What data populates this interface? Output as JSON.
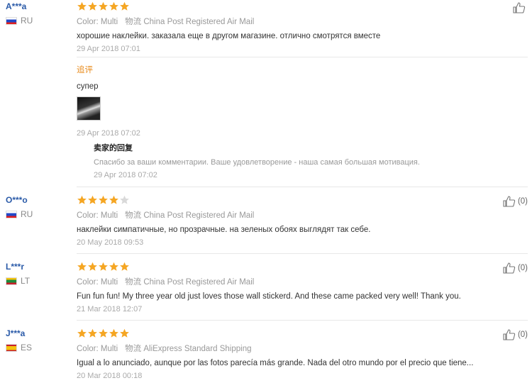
{
  "reviews": [
    {
      "user": "A***a",
      "country": "RU",
      "stars": 5,
      "color_label": "Color: Multi",
      "shipping": "物流 China Post Registered Air Mail",
      "text": "хорошие наклейки. заказала еще в другом магазине. отлично смотрятся вместе",
      "date": "29 Apr 2018 07:01",
      "helpful": "",
      "followup": {
        "label": "追评",
        "text": "супер",
        "date": "29 Apr 2018 07:02",
        "seller_title": "卖家的回复",
        "seller_text": "Спасибо за ваши комментарии. Ваше удовлетворение - наша самая большая мотивация.",
        "seller_date": "29 Apr 2018 07:02"
      }
    },
    {
      "user": "O***o",
      "country": "RU",
      "stars": 4,
      "color_label": "Color: Multi",
      "shipping": "物流 China Post Registered Air Mail",
      "text": "наклейки симпатичные, но прозрачные. на зеленых обоях выглядят так себе.",
      "date": "20 May 2018 09:53",
      "helpful": "(0)"
    },
    {
      "user": "L***r",
      "country": "LT",
      "stars": 5,
      "color_label": "Color: Multi",
      "shipping": "物流 China Post Registered Air Mail",
      "text": "Fun fun fun! My three year old just loves those wall stickerd. And these came packed very well! Thank you.",
      "date": "21 Mar 2018 12:07",
      "helpful": "(0)"
    },
    {
      "user": "J***a",
      "country": "ES",
      "stars": 5,
      "color_label": "Color: Multi",
      "shipping": "物流 AliExpress Standard Shipping",
      "text": "Igual a lo anunciado, aunque por las fotos parecía más grande. Nada del otro mundo por el precio que tiene...",
      "date": "20 Mar 2018 00:18",
      "helpful": "(0)"
    }
  ],
  "colors": {
    "star_on": "#f5a623",
    "star_off": "#d9d9d9",
    "username": "#2a5aa8",
    "followup": "#e88a1a"
  }
}
